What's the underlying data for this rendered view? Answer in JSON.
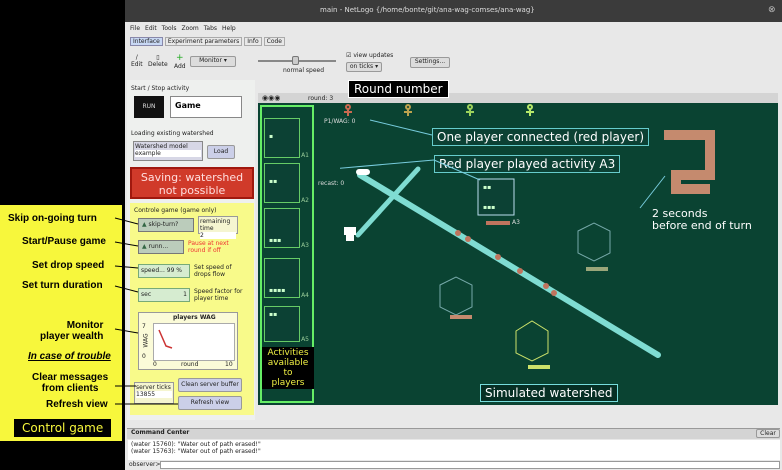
{
  "window": {
    "title": "main - NetLogo {/home/bonte/git/ana-wag-comses/ana-wag}",
    "close": "⊗"
  },
  "menu": [
    "File",
    "Edit",
    "Tools",
    "Zoom",
    "Tabs",
    "Help"
  ],
  "tabs": [
    "Interface",
    "Experiment parameters",
    "Info",
    "Code"
  ],
  "toolbar": {
    "edit": "Edit",
    "delete": "Delete",
    "add": "Add",
    "monitor": "Monitor",
    "speed": "normal speed",
    "view_updates": "view updates",
    "on_ticks": "on ticks",
    "settings": "Settings..."
  },
  "left": {
    "start_stop": "Start / Stop activity",
    "run": "RUN",
    "game_chooser": "Game",
    "loading": "Loading existing watershed",
    "watershed_model_label": "Watershed model",
    "watershed_model_value": "example",
    "load": "Load",
    "saving": "Saving: watershed not possible",
    "controle_game": "Controle game (game only)",
    "skip_turn": "skip-turn?",
    "remaining_label": "remaining time",
    "remaining_value": "2",
    "run_btn": "runn...",
    "pause_note": "Pause at next round if off",
    "speed": "speed... 99 %",
    "speed_note": "Set speed of drops flow",
    "duration": "sec",
    "duration_val": "1",
    "duration_note": "Speed factor for player time",
    "plot_title": "players WAG",
    "plot_y": "WAG",
    "plot_ymax": "7",
    "plot_ymin": "0",
    "plot_x": "round",
    "plot_xmin": "0",
    "plot_xmax": "10",
    "server_ticks_label": "server ticks",
    "server_ticks_value": "13855",
    "clean": "Clean server buffer",
    "refresh": "Refresh view"
  },
  "annotations": {
    "skip": "Skip on-going turn",
    "start": "Start/Pause game",
    "drop": "Set drop speed",
    "turn": "Set turn duration",
    "monitor": "Monitor\nplayer wealth",
    "trouble": "In case of trouble",
    "clear": "Clear messages\nfrom clients",
    "refresh": "Refresh view",
    "control_game": "Control game",
    "round_number": "Round number",
    "one_player": "One player connected (red player)",
    "red_played": "Red player played activity A3",
    "two_seconds": "2 seconds\nbefore end of turn",
    "activities": "Activities\navailable\nto\nplayers",
    "simulated": "Simulated watershed"
  },
  "view": {
    "round": "round: 3",
    "p1": "P1/WAG: 0",
    "recast": "recast: 0",
    "a3": "A3",
    "big_number": "2"
  },
  "activities": [
    "A1",
    "A2",
    "A3",
    "A4",
    "A5"
  ],
  "command_center": {
    "title": "Command Center",
    "lines": [
      "(water 15760): \"Water out of path erased!\"",
      "(water 15763): \"Water out of path erased!\""
    ],
    "observer": "observer>",
    "clear": "Clear"
  }
}
